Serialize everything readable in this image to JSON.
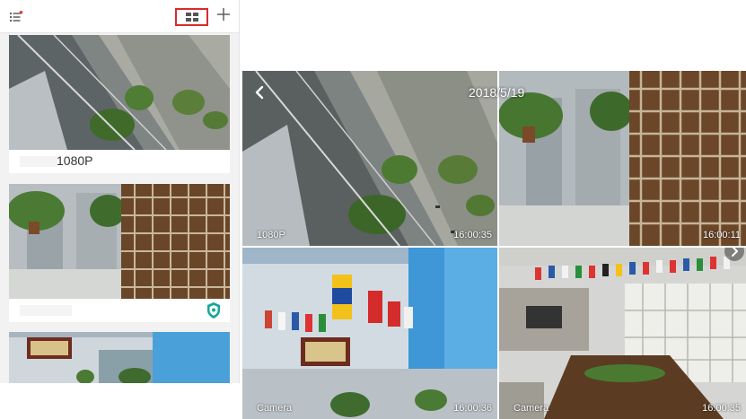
{
  "list_view": {
    "cards": [
      {
        "name": "1080P"
      },
      {
        "name": ""
      },
      {
        "name": ""
      }
    ]
  },
  "grid_view": {
    "date": "2018/5/19",
    "tiles": [
      {
        "name": "1080P",
        "time": "16:00:35"
      },
      {
        "name": "",
        "time": "16:00:11"
      },
      {
        "name": "Camera",
        "time": "16:00:36"
      },
      {
        "name": "Camera",
        "time": "16:00:35"
      }
    ]
  },
  "colors": {
    "highlight_border": "#d82b2b",
    "notification_dot": "#e53935",
    "shield": "#16a79a"
  },
  "icons": [
    "menu-icon",
    "grid-layout-icon",
    "plus-icon",
    "shield-icon",
    "chevron-left-icon",
    "chevron-right-icon"
  ]
}
